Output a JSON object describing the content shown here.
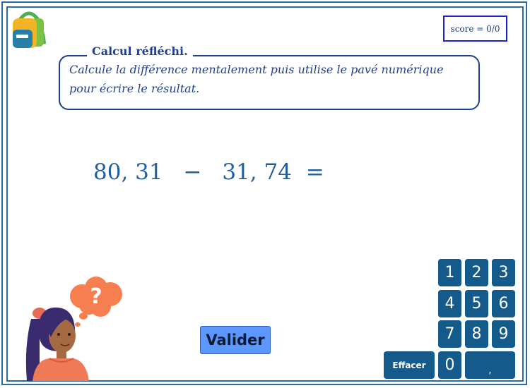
{
  "score": {
    "label": "score = 0/0"
  },
  "instructions": {
    "title": "Calcul réfléchi.",
    "line1": "Calcule la différence mentalement puis utilise le pavé numérique",
    "line2": "pour écrire le résultat."
  },
  "problem": {
    "operand1": "80, 31",
    "operator": "−",
    "operand2": "31, 74",
    "equals": "="
  },
  "buttons": {
    "validate_label": "Valider",
    "clear_label": "Effacer"
  },
  "keypad": {
    "k1": "1",
    "k2": "2",
    "k3": "3",
    "k4": "4",
    "k5": "5",
    "k6": "6",
    "k7": "7",
    "k8": "8",
    "k9": "9",
    "k0": "0",
    "comma": ","
  },
  "thought_bubble": {
    "symbol": "?"
  },
  "colors": {
    "frame": "#2b6aa3",
    "text_primary": "#1f3f8f",
    "problem_text": "#1f5fa0",
    "key_bg": "#145a8a",
    "validate_bg": "#5b97ff",
    "bubble": "#f77e4e"
  }
}
